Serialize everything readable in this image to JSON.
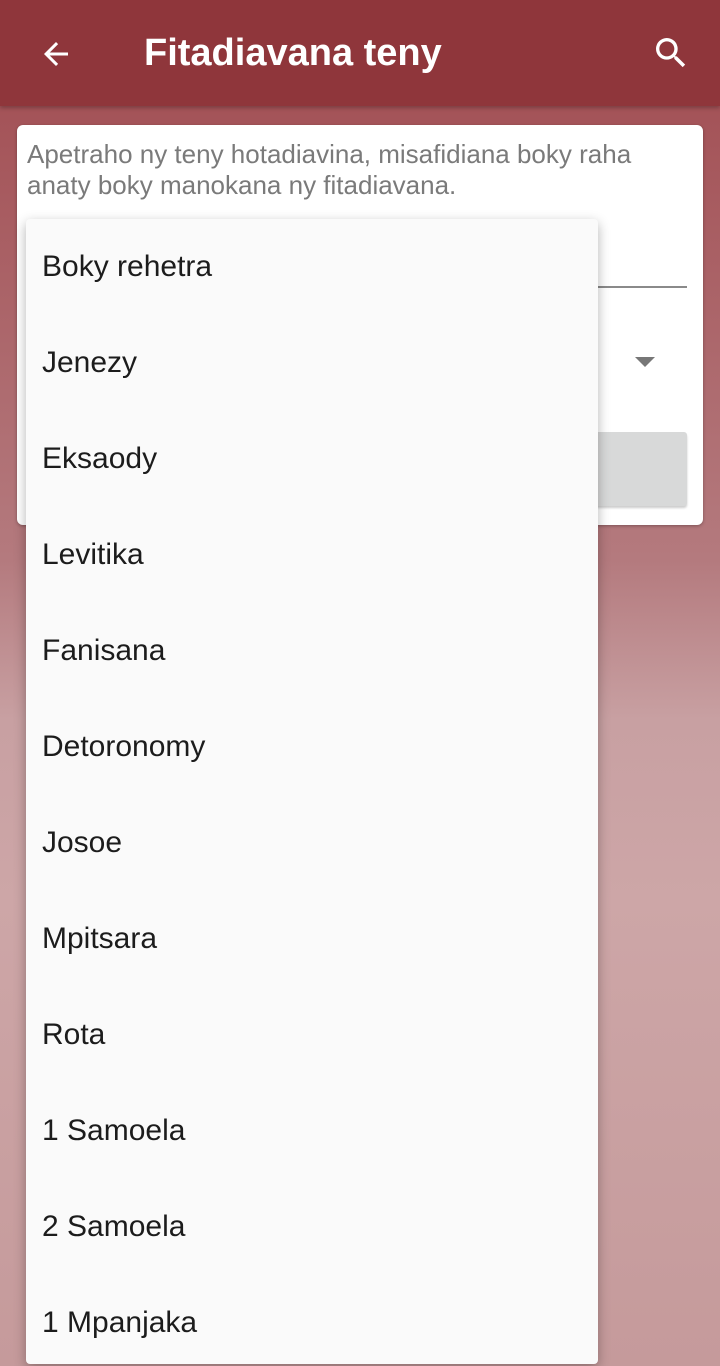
{
  "app_bar": {
    "title": "Fitadiavana teny",
    "back_icon": "arrow-left-icon",
    "search_icon": "search-icon",
    "background_color": "#8f363b"
  },
  "form": {
    "description": "Apetraho ny teny hotadiavina, misafidiana boky raha anaty boky manokana ny fitadiavana."
  },
  "book_dropdown": {
    "options": [
      "Boky rehetra",
      "Jenezy",
      "Eksaody",
      "Levitika",
      "Fanisana",
      "Detoronomy",
      "Josoe",
      "Mpitsara",
      "Rota",
      "1 Samoela",
      "2 Samoela",
      "1 Mpanjaka"
    ]
  }
}
